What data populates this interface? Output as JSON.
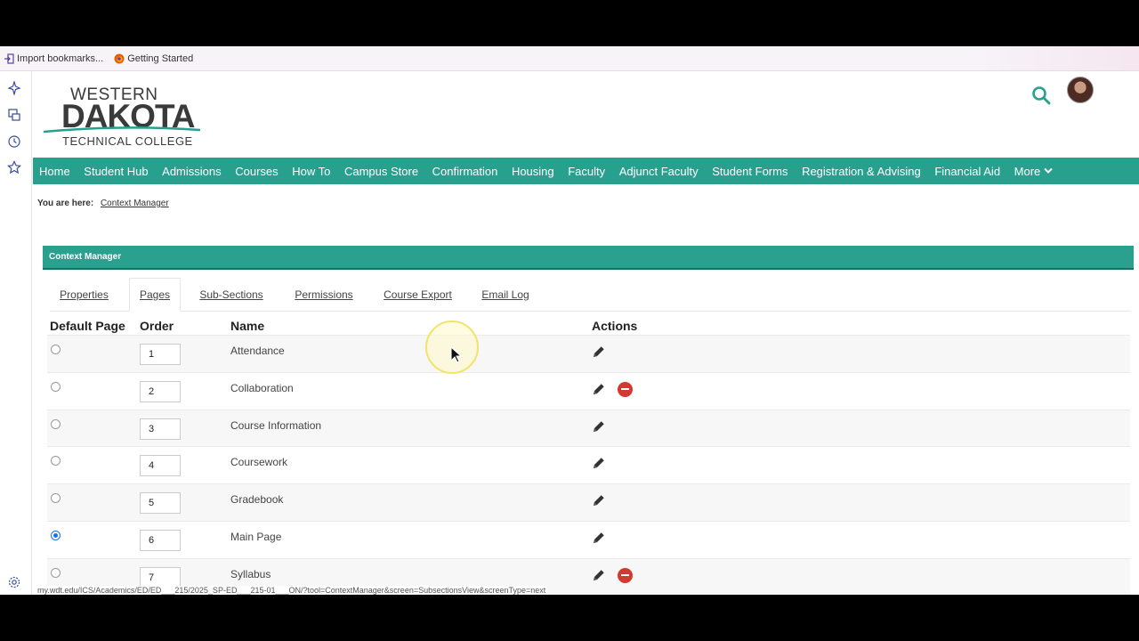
{
  "browser": {
    "bookmarks": [
      {
        "label": "Import bookmarks...",
        "icon": "import-icon"
      },
      {
        "label": "Getting Started",
        "icon": "firefox-icon"
      }
    ],
    "status_url": "my.wdt.edu/ICS/Academics/ED/ED___215/2025_SP-ED___215-01___ON/?tool=ContextManager&screen=SubsectionsView&screenType=next"
  },
  "site": {
    "logo": {
      "line1": "WESTERN",
      "line2": "DAKOTA",
      "line3": "TECHNICAL COLLEGE",
      "accent_color": "#27a08e"
    },
    "nav": [
      "Home",
      "Student Hub",
      "Admissions",
      "Courses",
      "How To",
      "Campus Store",
      "Confirmation",
      "Housing",
      "Faculty",
      "Adjunct Faculty",
      "Student Forms",
      "Registration & Advising",
      "Financial Aid",
      "More"
    ],
    "breadcrumb": {
      "label": "You are here:",
      "link": "Context Manager"
    }
  },
  "panel": {
    "title": "Context Manager",
    "tabs": [
      "Properties",
      "Pages",
      "Sub-Sections",
      "Permissions",
      "Course Export",
      "Email Log"
    ],
    "active_tab": "Pages"
  },
  "table": {
    "headers": {
      "default_page": "Default Page",
      "order": "Order",
      "name": "Name",
      "actions": "Actions"
    },
    "rows": [
      {
        "order": "1",
        "name": "Attendance",
        "default": false,
        "deletable": false
      },
      {
        "order": "2",
        "name": "Collaboration",
        "default": false,
        "deletable": true
      },
      {
        "order": "3",
        "name": "Course Information",
        "default": false,
        "deletable": false
      },
      {
        "order": "4",
        "name": "Coursework",
        "default": false,
        "deletable": false
      },
      {
        "order": "5",
        "name": "Gradebook",
        "default": false,
        "deletable": false
      },
      {
        "order": "6",
        "name": "Main Page",
        "default": true,
        "deletable": false
      },
      {
        "order": "7",
        "name": "Syllabus",
        "default": false,
        "deletable": true
      }
    ]
  }
}
